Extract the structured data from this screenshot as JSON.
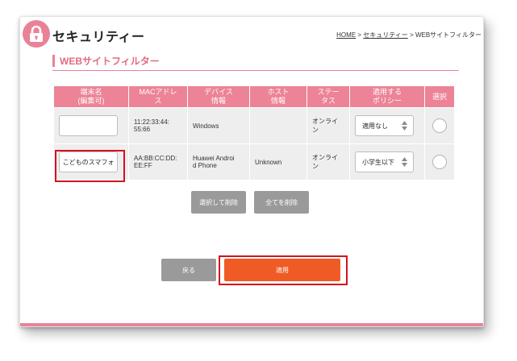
{
  "header": {
    "title": "セキュリティー",
    "breadcrumb": {
      "home": "HOME",
      "sep1": " > ",
      "security": "セキュリティー",
      "sep2": " > ",
      "current": "WEBサイトフィルター"
    }
  },
  "section": {
    "title": "WEBサイトフィルター"
  },
  "table": {
    "headers": {
      "name": "端末名\n(編集可)",
      "mac": "MACアドレ\nス",
      "device": "デバイス\n情報",
      "host": "ホスト\n情報",
      "status": "ステー\nタス",
      "policy": "適用する\nポリシー",
      "select": "選択"
    },
    "rows": [
      {
        "name": "",
        "mac": "11:22:33:44:\n55:66",
        "device": "Windows",
        "host": "",
        "status": "オンライ\nン",
        "policy": "適用なし"
      },
      {
        "name": "こどものスマフォ",
        "mac": "AA:BB:CC:DD:\nEE:FF",
        "device": "Huawei Androi\nd Phone",
        "host": "Unknown",
        "status": "オンライ\nン",
        "policy": "小学生以下"
      }
    ]
  },
  "actions": {
    "delete_selected": "選択して削除",
    "delete_all": "全てを削除"
  },
  "footer": {
    "back": "戻る",
    "apply": "適用"
  },
  "colors": {
    "accent": "#e98296",
    "header_bg": "#ec8397",
    "apply": "#f05a24",
    "highlight": "#d4121e",
    "button_gray": "#9a9a9a"
  }
}
